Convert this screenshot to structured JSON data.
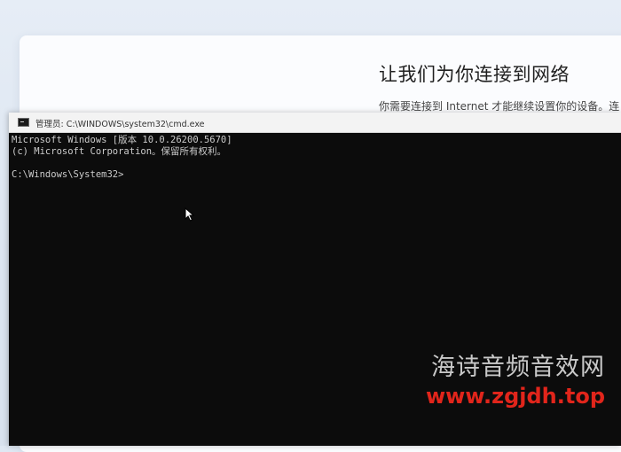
{
  "oobe": {
    "title": "让我们为你连接到网络",
    "subtitle": "你需要连接到 Internet 才能继续设置你的设备。连"
  },
  "cmd": {
    "window_title": "管理员: C:\\WINDOWS\\system32\\cmd.exe",
    "lines": [
      "Microsoft Windows [版本 10.0.26200.5670]",
      "(c) Microsoft Corporation。保留所有权利。",
      "C:\\Windows\\System32>"
    ],
    "colors": {
      "background": "#0c0c0c",
      "text": "#cccccc"
    }
  },
  "watermark": {
    "name": "海诗音频音效网",
    "url": "www.zgjdh.top",
    "url_color": "#e1251b"
  },
  "icons": {
    "app_icon": "cmd-icon",
    "pointer": "mouse-pointer-icon"
  }
}
